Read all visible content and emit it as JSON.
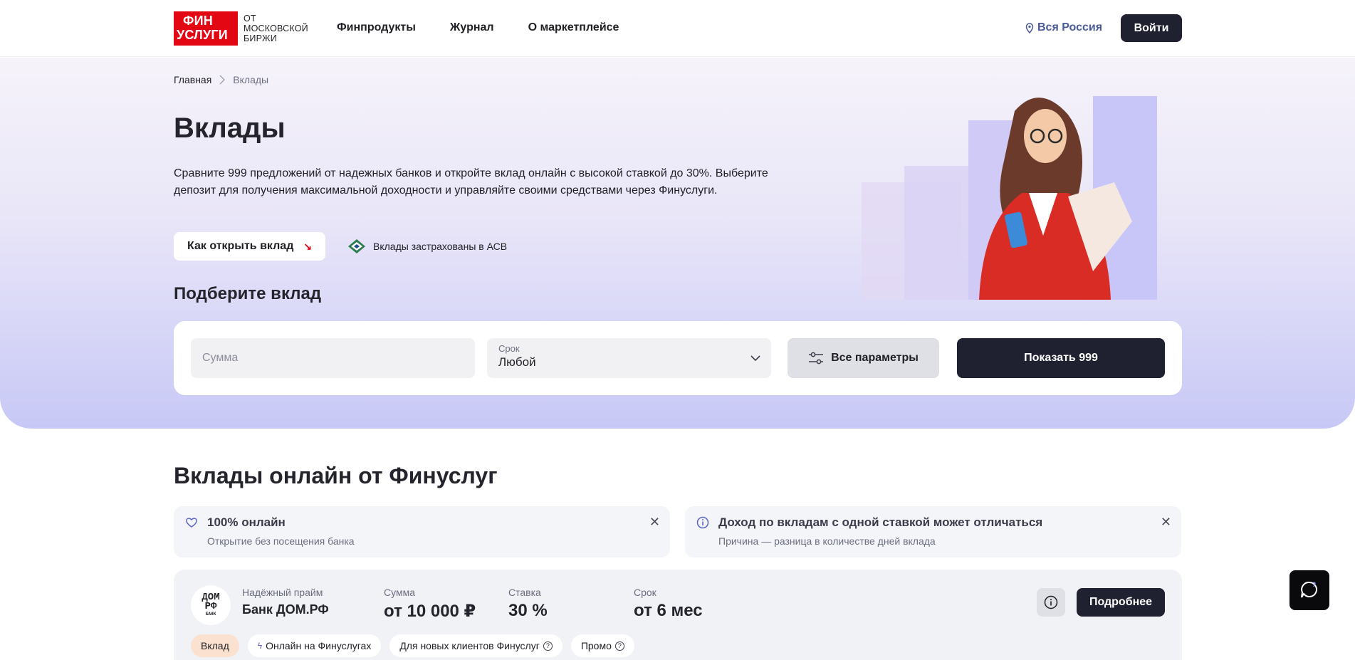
{
  "header": {
    "logo_line1": "ФИН",
    "logo_line2": "УСЛУГИ",
    "logo_sub1": "ОТ",
    "logo_sub2": "МОСКОВСКОЙ",
    "logo_sub3": "БИРЖИ",
    "nav": [
      "Финпродукты",
      "Журнал",
      "О маркетплейсе"
    ],
    "region": "Вся Россия",
    "login": "Войти"
  },
  "breadcrumb": {
    "home": "Главная",
    "current": "Вклады"
  },
  "hero": {
    "title": "Вклады",
    "lead": "Сравните 999 предложений от надежных банков и откройте вклад онлайн с высокой ставкой до 30%. Выберите депозит для получения максимальной доходности и управляйте своими средствами через Финуслуги.",
    "howto_label": "Как открыть вклад",
    "asv_text": "Вклады застрахованы в АСВ",
    "pick_title": "Подберите вклад"
  },
  "filter": {
    "sum_placeholder": "Сумма",
    "term_label": "Срок",
    "term_value": "Любой",
    "params_label": "Все параметры",
    "show_label": "Показать 999"
  },
  "section_title": "Вклады онлайн от Финуслуг",
  "info_cards": [
    {
      "title": "100% онлайн",
      "text": "Открытие без посещения банка"
    },
    {
      "title": "Доход по вкладам с одной ставкой может отличаться",
      "text": "Причина — разница в количестве дней вклада"
    }
  ],
  "offer": {
    "logo_text_top": "ДОМ",
    "logo_text_mid": "РФ",
    "logo_text_bot": "БАНК",
    "product_label": "Надёжный прайм",
    "bank_name": "Банк ДОМ.РФ",
    "sum_label": "Сумма",
    "sum_value": "от 10 000 ₽",
    "rate_label": "Ставка",
    "rate_value": "30 %",
    "term_label": "Срок",
    "term_value": "от 6 мес",
    "details_label": "Подробнее",
    "tags": [
      "Вклад",
      "Онлайн на Финуслугах",
      "Для новых клиентов Финуслуг",
      "Промо"
    ]
  },
  "colors": {
    "brand_red": "#e30613",
    "dark": "#1f2130",
    "hero_bottom": "#c7c8f6"
  }
}
